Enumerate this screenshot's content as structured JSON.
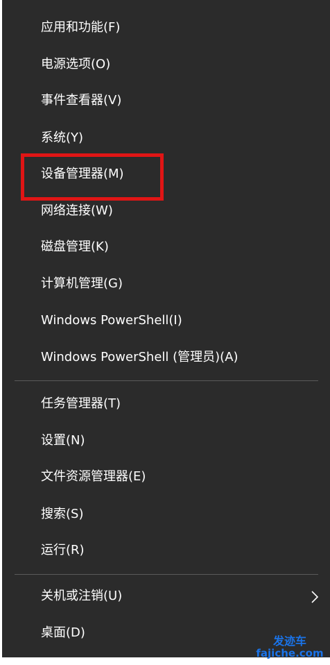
{
  "menu": {
    "group1": [
      {
        "label": "应用和功能(F)"
      },
      {
        "label": "电源选项(O)"
      },
      {
        "label": "事件查看器(V)"
      },
      {
        "label": "系统(Y)"
      },
      {
        "label": "设备管理器(M)"
      },
      {
        "label": "网络连接(W)"
      },
      {
        "label": "磁盘管理(K)"
      },
      {
        "label": "计算机管理(G)"
      },
      {
        "label": "Windows PowerShell(I)"
      },
      {
        "label": "Windows PowerShell (管理员)(A)"
      }
    ],
    "group2": [
      {
        "label": "任务管理器(T)"
      },
      {
        "label": "设置(N)"
      },
      {
        "label": "文件资源管理器(E)"
      },
      {
        "label": "搜索(S)"
      },
      {
        "label": "运行(R)"
      }
    ],
    "group3": [
      {
        "label": "关机或注销(U)"
      },
      {
        "label": "桌面(D)"
      }
    ]
  },
  "watermark": {
    "line1": "发迹车",
    "line2": "fajiche.com"
  },
  "colors": {
    "menu_bg": "#2b2b2b",
    "text": "#ffffff",
    "highlight": "#e01515",
    "separator": "#5a5a5a",
    "watermark": "#1a73e8"
  }
}
